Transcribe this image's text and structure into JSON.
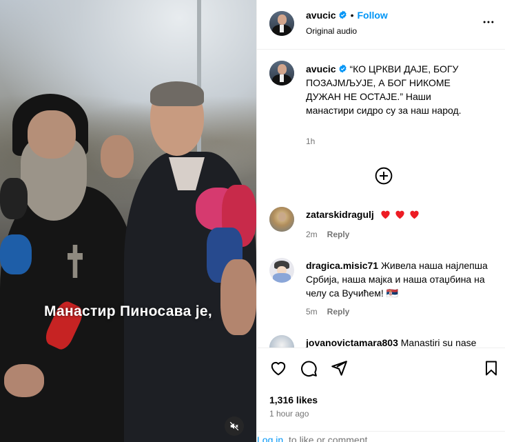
{
  "post": {
    "username": "avucic",
    "follow_label": "Follow",
    "audio_label": "Original audio",
    "more_label": "•••"
  },
  "media": {
    "caption_overlay": "Манастир Пиносава је,",
    "mute_icon": "speaker-muted-icon"
  },
  "caption": {
    "username": "avucic",
    "text": "“КО ЦРКВИ ДАЈЕ, БОГУ ПОЗАЈМЉУЈЕ, А БОГ НИКОМЕ ДУЖАН НЕ ОСТАЈЕ.” Наши манастири сидро су за наш народ.",
    "time": "1h"
  },
  "load_more_icon": "plus-circle-icon",
  "comments": [
    {
      "username": "zatarskidragulj",
      "text": "❤️❤️❤️",
      "time": "2m",
      "reply_label": "Reply"
    },
    {
      "username": "dragica.misic71",
      "text": "Живела наша најлепша Србија, наша мајка и наша отаџбина на челу са Вучићем! 🇷🇸",
      "time": "5m",
      "reply_label": "Reply"
    },
    {
      "username": "jovanovictamara803",
      "text": "Manastiri su nase"
    }
  ],
  "actions": {
    "likes": "1,316 likes",
    "time_ago": "1 hour ago"
  },
  "login": {
    "link": "Log in",
    "rest": "to like or comment."
  },
  "colors": {
    "accent": "#0095f6",
    "heart": "#ed1c24",
    "muted_text": "#737373"
  }
}
